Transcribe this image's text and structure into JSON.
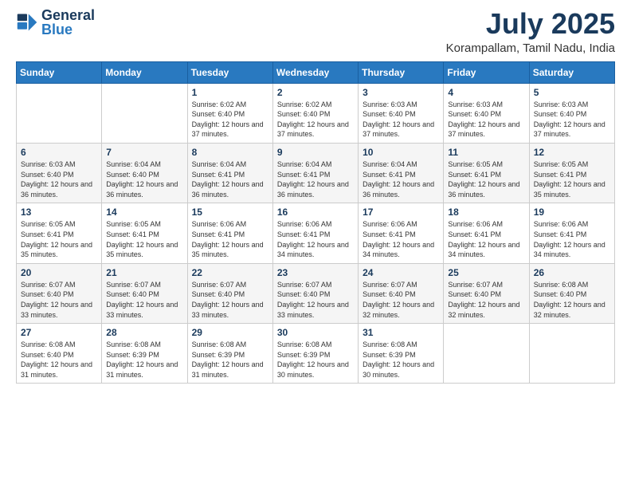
{
  "logo": {
    "text_general": "General",
    "text_blue": "Blue"
  },
  "header": {
    "title": "July 2025",
    "subtitle": "Korampallam, Tamil Nadu, India"
  },
  "columns": [
    "Sunday",
    "Monday",
    "Tuesday",
    "Wednesday",
    "Thursday",
    "Friday",
    "Saturday"
  ],
  "weeks": [
    [
      {
        "day": "",
        "info": ""
      },
      {
        "day": "",
        "info": ""
      },
      {
        "day": "1",
        "info": "Sunrise: 6:02 AM\nSunset: 6:40 PM\nDaylight: 12 hours and 37 minutes."
      },
      {
        "day": "2",
        "info": "Sunrise: 6:02 AM\nSunset: 6:40 PM\nDaylight: 12 hours and 37 minutes."
      },
      {
        "day": "3",
        "info": "Sunrise: 6:03 AM\nSunset: 6:40 PM\nDaylight: 12 hours and 37 minutes."
      },
      {
        "day": "4",
        "info": "Sunrise: 6:03 AM\nSunset: 6:40 PM\nDaylight: 12 hours and 37 minutes."
      },
      {
        "day": "5",
        "info": "Sunrise: 6:03 AM\nSunset: 6:40 PM\nDaylight: 12 hours and 37 minutes."
      }
    ],
    [
      {
        "day": "6",
        "info": "Sunrise: 6:03 AM\nSunset: 6:40 PM\nDaylight: 12 hours and 36 minutes."
      },
      {
        "day": "7",
        "info": "Sunrise: 6:04 AM\nSunset: 6:40 PM\nDaylight: 12 hours and 36 minutes."
      },
      {
        "day": "8",
        "info": "Sunrise: 6:04 AM\nSunset: 6:41 PM\nDaylight: 12 hours and 36 minutes."
      },
      {
        "day": "9",
        "info": "Sunrise: 6:04 AM\nSunset: 6:41 PM\nDaylight: 12 hours and 36 minutes."
      },
      {
        "day": "10",
        "info": "Sunrise: 6:04 AM\nSunset: 6:41 PM\nDaylight: 12 hours and 36 minutes."
      },
      {
        "day": "11",
        "info": "Sunrise: 6:05 AM\nSunset: 6:41 PM\nDaylight: 12 hours and 36 minutes."
      },
      {
        "day": "12",
        "info": "Sunrise: 6:05 AM\nSunset: 6:41 PM\nDaylight: 12 hours and 35 minutes."
      }
    ],
    [
      {
        "day": "13",
        "info": "Sunrise: 6:05 AM\nSunset: 6:41 PM\nDaylight: 12 hours and 35 minutes."
      },
      {
        "day": "14",
        "info": "Sunrise: 6:05 AM\nSunset: 6:41 PM\nDaylight: 12 hours and 35 minutes."
      },
      {
        "day": "15",
        "info": "Sunrise: 6:06 AM\nSunset: 6:41 PM\nDaylight: 12 hours and 35 minutes."
      },
      {
        "day": "16",
        "info": "Sunrise: 6:06 AM\nSunset: 6:41 PM\nDaylight: 12 hours and 34 minutes."
      },
      {
        "day": "17",
        "info": "Sunrise: 6:06 AM\nSunset: 6:41 PM\nDaylight: 12 hours and 34 minutes."
      },
      {
        "day": "18",
        "info": "Sunrise: 6:06 AM\nSunset: 6:41 PM\nDaylight: 12 hours and 34 minutes."
      },
      {
        "day": "19",
        "info": "Sunrise: 6:06 AM\nSunset: 6:41 PM\nDaylight: 12 hours and 34 minutes."
      }
    ],
    [
      {
        "day": "20",
        "info": "Sunrise: 6:07 AM\nSunset: 6:40 PM\nDaylight: 12 hours and 33 minutes."
      },
      {
        "day": "21",
        "info": "Sunrise: 6:07 AM\nSunset: 6:40 PM\nDaylight: 12 hours and 33 minutes."
      },
      {
        "day": "22",
        "info": "Sunrise: 6:07 AM\nSunset: 6:40 PM\nDaylight: 12 hours and 33 minutes."
      },
      {
        "day": "23",
        "info": "Sunrise: 6:07 AM\nSunset: 6:40 PM\nDaylight: 12 hours and 33 minutes."
      },
      {
        "day": "24",
        "info": "Sunrise: 6:07 AM\nSunset: 6:40 PM\nDaylight: 12 hours and 32 minutes."
      },
      {
        "day": "25",
        "info": "Sunrise: 6:07 AM\nSunset: 6:40 PM\nDaylight: 12 hours and 32 minutes."
      },
      {
        "day": "26",
        "info": "Sunrise: 6:08 AM\nSunset: 6:40 PM\nDaylight: 12 hours and 32 minutes."
      }
    ],
    [
      {
        "day": "27",
        "info": "Sunrise: 6:08 AM\nSunset: 6:40 PM\nDaylight: 12 hours and 31 minutes."
      },
      {
        "day": "28",
        "info": "Sunrise: 6:08 AM\nSunset: 6:39 PM\nDaylight: 12 hours and 31 minutes."
      },
      {
        "day": "29",
        "info": "Sunrise: 6:08 AM\nSunset: 6:39 PM\nDaylight: 12 hours and 31 minutes."
      },
      {
        "day": "30",
        "info": "Sunrise: 6:08 AM\nSunset: 6:39 PM\nDaylight: 12 hours and 30 minutes."
      },
      {
        "day": "31",
        "info": "Sunrise: 6:08 AM\nSunset: 6:39 PM\nDaylight: 12 hours and 30 minutes."
      },
      {
        "day": "",
        "info": ""
      },
      {
        "day": "",
        "info": ""
      }
    ]
  ]
}
